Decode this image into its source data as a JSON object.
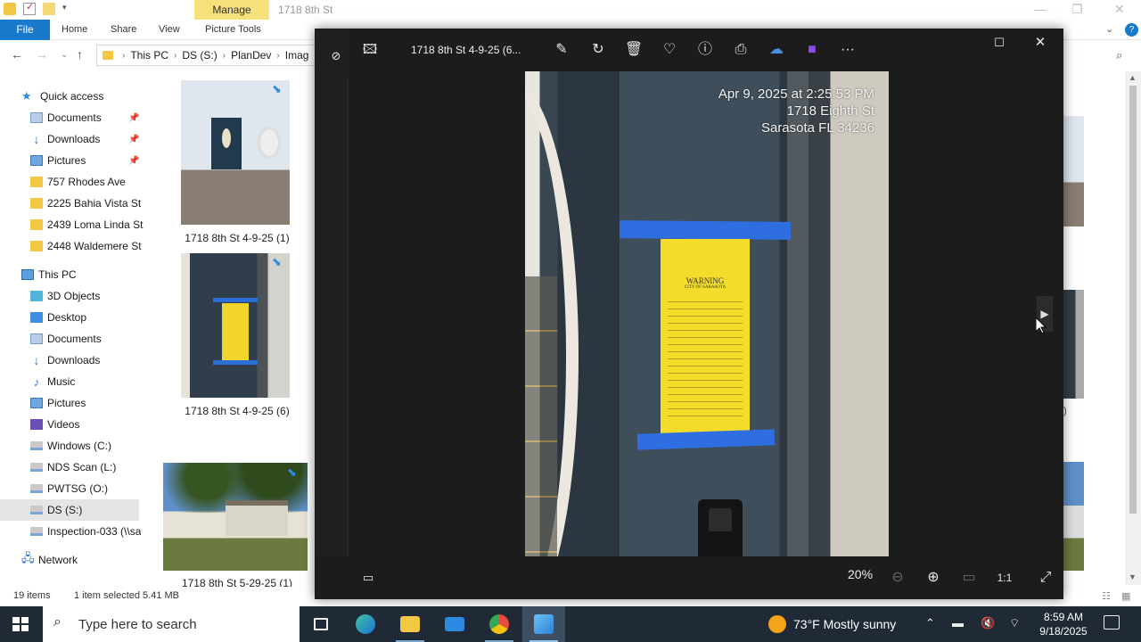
{
  "explorer": {
    "title": "1718 8th St",
    "ribbon_context_label": "Manage",
    "tabs": [
      "File",
      "Home",
      "Share",
      "View",
      "Picture Tools"
    ],
    "address": [
      "This PC",
      "DS (S:)",
      "PlanDev",
      "Imag"
    ],
    "sidebar": {
      "quick_access": "Quick access",
      "quick_items": [
        {
          "label": "Documents",
          "icon": "documents-icon",
          "pinned": true
        },
        {
          "label": "Downloads",
          "icon": "downloads-icon",
          "pinned": true
        },
        {
          "label": "Pictures",
          "icon": "pictures-icon",
          "pinned": true
        },
        {
          "label": "757 Rhodes Ave",
          "icon": "folder-icon"
        },
        {
          "label": "2225 Bahia Vista St",
          "icon": "folder-icon"
        },
        {
          "label": "2439 Loma Linda St",
          "icon": "folder-icon"
        },
        {
          "label": "2448 Waldemere St",
          "icon": "folder-icon"
        }
      ],
      "this_pc": "This PC",
      "pc_items": [
        {
          "label": "3D Objects",
          "icon": "3d-objects-icon"
        },
        {
          "label": "Desktop",
          "icon": "desktop-icon"
        },
        {
          "label": "Documents",
          "icon": "documents-icon"
        },
        {
          "label": "Downloads",
          "icon": "downloads-icon"
        },
        {
          "label": "Music",
          "icon": "music-icon"
        },
        {
          "label": "Pictures",
          "icon": "pictures-icon"
        },
        {
          "label": "Videos",
          "icon": "videos-icon"
        },
        {
          "label": "Windows (C:)",
          "icon": "drive-icon"
        },
        {
          "label": "NDS Scan (L:)",
          "icon": "network-drive-icon"
        },
        {
          "label": "PWTSG (O:)",
          "icon": "network-drive-icon"
        },
        {
          "label": "DS (S:)",
          "icon": "network-drive-icon",
          "selected": true
        },
        {
          "label": "Inspection-033 (\\\\sa",
          "icon": "network-drive-icon"
        }
      ],
      "network": "Network"
    },
    "files": [
      {
        "name": "1718 8th St 4-9-25 (1)"
      },
      {
        "name": "1718 8th St 4-9-25 (6)"
      },
      {
        "name": "1718 8th St 5-29-25 (1)"
      }
    ],
    "partial_right_label": ")",
    "status": {
      "count": "19 items",
      "selection": "1 item selected  5.41 MB"
    }
  },
  "viewer": {
    "title": "1718 8th St 4-9-25 (6...",
    "toolbar_icons": [
      "image-icon",
      "edit-icon",
      "rotate-icon",
      "delete-icon",
      "favorite-icon",
      "info-icon",
      "print-icon",
      "onedrive-icon",
      "clipchamp-icon",
      "more-icon"
    ],
    "zoom": "20%",
    "photo": {
      "stamp_lines": [
        "Apr 9, 2025 at 2:25:53 PM",
        "1718 Eighth St",
        "Sarasota FL 34236"
      ],
      "notice_title": "WARNING",
      "notice_sub": "CITY OF SARASOTA"
    }
  },
  "taskbar": {
    "search_placeholder": "Type here to search",
    "weather": "73°F  Mostly sunny",
    "time": "8:59 AM",
    "date": "9/18/2025"
  }
}
